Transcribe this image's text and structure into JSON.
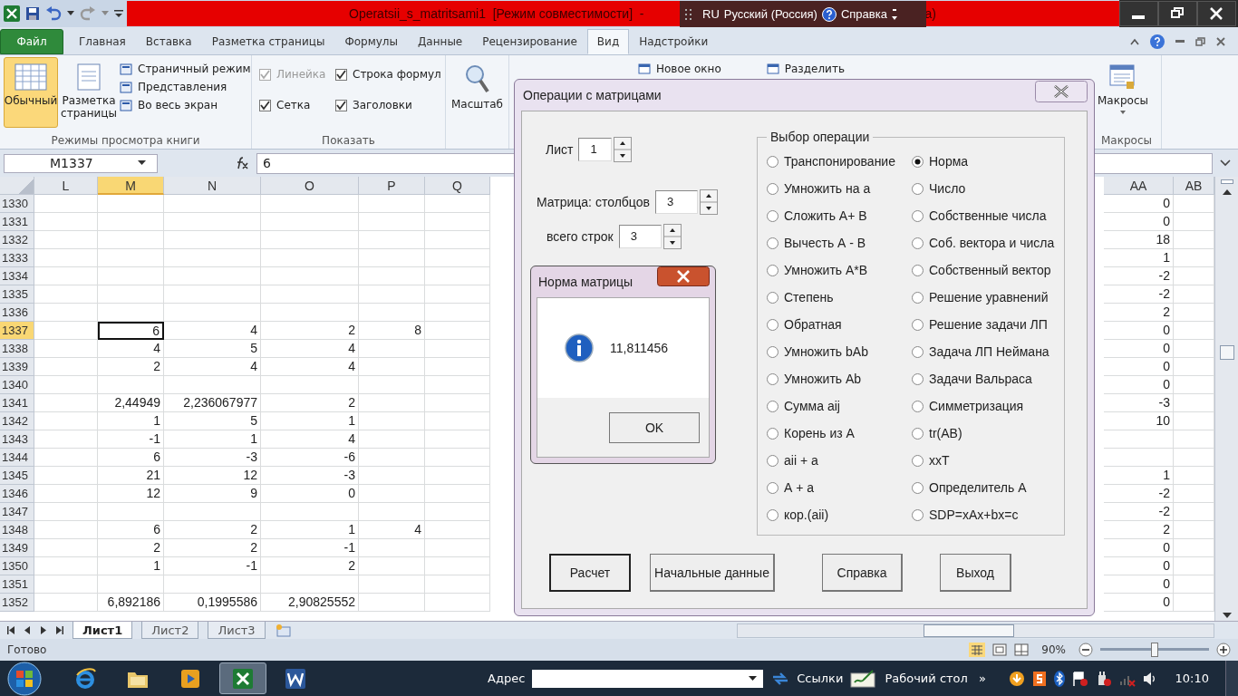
{
  "title_bar": {
    "title": "Operatsii_s_matritsami1  [Режим совместимости]  -",
    "title_tail": "a)"
  },
  "language_bar": {
    "code": "RU",
    "language": "Русский (Россия)",
    "help": "Справка"
  },
  "ribbon_tabs": [
    {
      "label": "Файл",
      "kind": "file",
      "selected": false
    },
    {
      "label": "Главная",
      "kind": "tab",
      "selected": false
    },
    {
      "label": "Вставка",
      "kind": "tab",
      "selected": false
    },
    {
      "label": "Разметка страницы",
      "kind": "tab",
      "selected": false
    },
    {
      "label": "Формулы",
      "kind": "tab",
      "selected": false
    },
    {
      "label": "Данные",
      "kind": "tab",
      "selected": false
    },
    {
      "label": "Рецензирование",
      "kind": "tab",
      "selected": false
    },
    {
      "label": "Вид",
      "kind": "tab",
      "selected": true
    },
    {
      "label": "Надстройки",
      "kind": "tab",
      "selected": false
    }
  ],
  "ribbon": {
    "view_modes": {
      "label": "Режимы просмотра книги",
      "large": [
        {
          "label": "Обычный",
          "selected": true
        },
        {
          "label": "Разметка страницы",
          "selected": false
        }
      ],
      "small": [
        "Страничный режим",
        "Представления",
        "Во весь экран"
      ]
    },
    "show": {
      "label": "Показать",
      "checks": [
        {
          "label": "Линейка",
          "checked": true,
          "disabled": true
        },
        {
          "label": "Строка формул",
          "checked": true,
          "disabled": false
        },
        {
          "label": "Сетка",
          "checked": true,
          "disabled": false
        },
        {
          "label": "Заголовки",
          "checked": true,
          "disabled": false
        }
      ]
    },
    "zoom": {
      "label": "Масштаб"
    },
    "window": {
      "items": [
        "Новое окно",
        "Разделить"
      ]
    },
    "macros": {
      "button": "Макросы",
      "label": "Макросы"
    }
  },
  "formula_bar": {
    "name_box": "M1337",
    "formula": "6"
  },
  "sheet": {
    "columns": [
      {
        "label": "L",
        "selected": false
      },
      {
        "label": "M",
        "selected": true
      },
      {
        "label": "N",
        "selected": false
      },
      {
        "label": "O",
        "selected": false
      },
      {
        "label": "P",
        "selected": false
      },
      {
        "label": "Q",
        "selected": false
      },
      {
        "label": "AA",
        "selected": false
      },
      {
        "label": "AB",
        "selected": false
      }
    ],
    "rows": [
      {
        "header": "1330",
        "selected": false,
        "cells": [
          null,
          null,
          null,
          null,
          null,
          null,
          "0",
          null
        ]
      },
      {
        "header": "1331",
        "selected": false,
        "cells": [
          null,
          null,
          null,
          null,
          null,
          null,
          "0",
          null
        ]
      },
      {
        "header": "1332",
        "selected": false,
        "cells": [
          null,
          null,
          null,
          null,
          null,
          null,
          "18",
          null
        ]
      },
      {
        "header": "1333",
        "selected": false,
        "cells": [
          null,
          null,
          null,
          null,
          null,
          null,
          "1",
          null
        ]
      },
      {
        "header": "1334",
        "selected": false,
        "cells": [
          null,
          null,
          null,
          null,
          null,
          null,
          "-2",
          null
        ]
      },
      {
        "header": "1335",
        "selected": false,
        "cells": [
          null,
          null,
          null,
          null,
          null,
          null,
          "-2",
          null
        ]
      },
      {
        "header": "1336",
        "selected": false,
        "cells": [
          null,
          null,
          null,
          null,
          null,
          null,
          "2",
          null
        ]
      },
      {
        "header": "1337",
        "selected": true,
        "cells": [
          null,
          "6",
          "4",
          "2",
          "8",
          null,
          "0",
          null
        ]
      },
      {
        "header": "1338",
        "selected": false,
        "cells": [
          null,
          "4",
          "5",
          "4",
          null,
          null,
          "0",
          null
        ]
      },
      {
        "header": "1339",
        "selected": false,
        "cells": [
          null,
          "2",
          "4",
          "4",
          null,
          null,
          "0",
          null
        ]
      },
      {
        "header": "1340",
        "selected": false,
        "cells": [
          null,
          null,
          null,
          null,
          null,
          null,
          "0",
          null
        ]
      },
      {
        "header": "1341",
        "selected": false,
        "cells": [
          null,
          "2,44949",
          "2,236067977",
          "2",
          null,
          null,
          "-3",
          null
        ]
      },
      {
        "header": "1342",
        "selected": false,
        "cells": [
          null,
          "1",
          "5",
          "1",
          null,
          null,
          "10",
          null
        ]
      },
      {
        "header": "1343",
        "selected": false,
        "cells": [
          null,
          "-1",
          "1",
          "4",
          null,
          null,
          null,
          null
        ]
      },
      {
        "header": "1344",
        "selected": false,
        "cells": [
          null,
          "6",
          "-3",
          "-6",
          null,
          null,
          null,
          null
        ]
      },
      {
        "header": "1345",
        "selected": false,
        "cells": [
          null,
          "21",
          "12",
          "-3",
          null,
          null,
          "1",
          null
        ]
      },
      {
        "header": "1346",
        "selected": false,
        "cells": [
          null,
          "12",
          "9",
          "0",
          null,
          null,
          "-2",
          null
        ]
      },
      {
        "header": "1347",
        "selected": false,
        "cells": [
          null,
          null,
          null,
          null,
          null,
          null,
          "-2",
          null
        ]
      },
      {
        "header": "1348",
        "selected": false,
        "cells": [
          null,
          "6",
          "2",
          "1",
          "4",
          null,
          "2",
          null
        ]
      },
      {
        "header": "1349",
        "selected": false,
        "cells": [
          null,
          "2",
          "2",
          "-1",
          null,
          null,
          "0",
          null
        ]
      },
      {
        "header": "1350",
        "selected": false,
        "cells": [
          null,
          "1",
          "-1",
          "2",
          null,
          null,
          "0",
          null
        ]
      },
      {
        "header": "1351",
        "selected": false,
        "cells": [
          null,
          null,
          null,
          null,
          null,
          null,
          "0",
          null
        ]
      },
      {
        "header": "1352",
        "selected": false,
        "cells": [
          null,
          "6,892186",
          "0,1995586",
          "2,90825552",
          null,
          null,
          "0",
          null
        ]
      }
    ]
  },
  "dialog": {
    "title": "Операции с матрицами",
    "sheet_label": "Лист",
    "sheet_value": "1",
    "cols_label": "Матрица: столбцов",
    "cols_value": "3",
    "rows_label": "всего строк",
    "rows_value": "3",
    "group_label": "Выбор операции",
    "operations": [
      {
        "label": "Транспонирование",
        "selected": false
      },
      {
        "label": "Норма",
        "selected": true
      },
      {
        "label": "Умножить на а",
        "selected": false
      },
      {
        "label": "Число",
        "selected": false
      },
      {
        "label": "Сложить А+ В",
        "selected": false
      },
      {
        "label": "Собственные числа",
        "selected": false
      },
      {
        "label": "Вычесть А - В",
        "selected": false
      },
      {
        "label": "Соб. вектора и числа",
        "selected": false
      },
      {
        "label": "Умножить А*В",
        "selected": false
      },
      {
        "label": "Собственный вектор",
        "selected": false
      },
      {
        "label": "Степень",
        "selected": false
      },
      {
        "label": "Решение уравнений",
        "selected": false
      },
      {
        "label": "Обратная",
        "selected": false
      },
      {
        "label": "Решение задачи ЛП",
        "selected": false
      },
      {
        "label": "Умножить bAb",
        "selected": false
      },
      {
        "label": "Задача ЛП Неймана",
        "selected": false
      },
      {
        "label": "Умножить Ab",
        "selected": false
      },
      {
        "label": "Задачи Вальраса",
        "selected": false
      },
      {
        "label": "Сумма aij",
        "selected": false
      },
      {
        "label": "Симметризация",
        "selected": false
      },
      {
        "label": "Корень из А",
        "selected": false
      },
      {
        "label": "tr(AB)",
        "selected": false
      },
      {
        "label": "aii + a",
        "selected": false
      },
      {
        "label": "xxT",
        "selected": false
      },
      {
        "label": "А + а",
        "selected": false
      },
      {
        "label": "Определитель А",
        "selected": false
      },
      {
        "label": "кор.(aii)",
        "selected": false
      },
      {
        "label": "SDP=xAx+bx=c",
        "selected": false
      }
    ],
    "buttons": [
      {
        "label": "Расчет",
        "default": true
      },
      {
        "label": "Начальные данные",
        "default": false
      },
      {
        "label": "Справка",
        "default": false
      },
      {
        "label": "Выход",
        "default": false
      }
    ]
  },
  "message_box": {
    "title": "Норма матрицы",
    "message": "11,811456",
    "button": "OK"
  },
  "sheet_tabs": [
    {
      "label": "Лист1",
      "selected": true
    },
    {
      "label": "Лист2",
      "selected": false
    },
    {
      "label": "Лист3",
      "selected": false
    }
  ],
  "status_bar": {
    "status": "Готово",
    "zoom": "90%",
    "zoom_slider": {
      "level": 0.5
    }
  },
  "taskbar": {
    "apps": [
      {
        "kind": "browser",
        "selected": false
      },
      {
        "kind": "folder",
        "selected": false
      },
      {
        "kind": "media",
        "selected": false
      },
      {
        "kind": "excel",
        "selected": true
      },
      {
        "kind": "word",
        "selected": false
      }
    ],
    "address_label": "Адрес",
    "links": "Ссылки",
    "desktop": "Рабочий стол",
    "more": "»",
    "time": "10:10"
  }
}
